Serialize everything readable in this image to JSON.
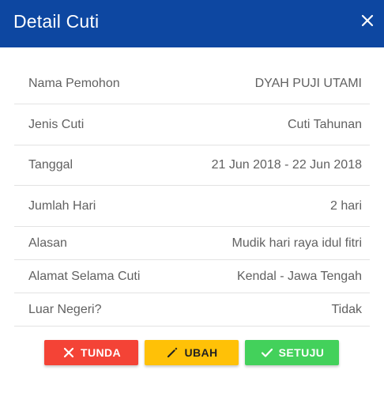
{
  "dialog": {
    "title": "Detail Cuti"
  },
  "details": [
    {
      "label": "Nama Pemohon",
      "value": "DYAH PUJI UTAMI"
    },
    {
      "label": "Jenis Cuti",
      "value": "Cuti Tahunan"
    },
    {
      "label": "Tanggal",
      "value": "21 Jun 2018 - 22 Jun 2018"
    },
    {
      "label": "Jumlah Hari",
      "value": "2 hari"
    },
    {
      "label": "Alasan",
      "value": "Mudik hari raya idul fitri"
    },
    {
      "label": "Alamat Selama Cuti",
      "value": "Kendal - Jawa Tengah"
    },
    {
      "label": "Luar Negeri?",
      "value": "Tidak"
    }
  ],
  "actions": {
    "tunda_label": "TUNDA",
    "ubah_label": "UBAH",
    "setuju_label": "SETUJU"
  },
  "icons": {
    "close": "close-icon",
    "tunda": "close-icon",
    "ubah": "pencil-icon",
    "setuju": "check-icon"
  },
  "colors": {
    "header": "#0d47a1",
    "tunda": "#f44336",
    "ubah": "#ffc107",
    "setuju": "#43d15b"
  }
}
